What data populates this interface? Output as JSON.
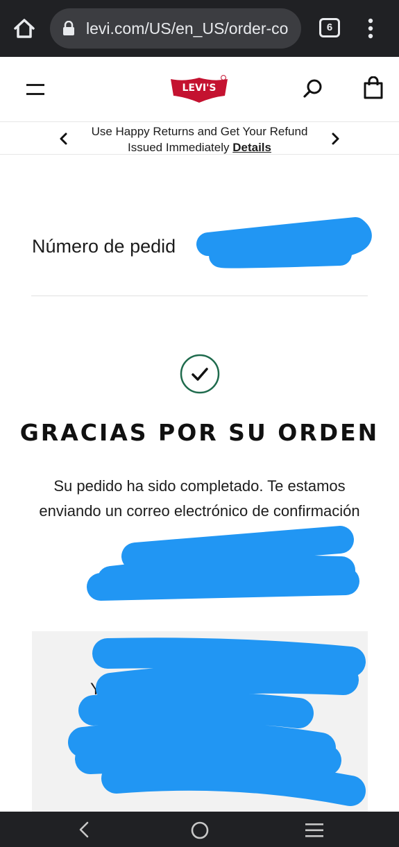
{
  "browser": {
    "url": "levi.com/US/en_US/order-co",
    "tab_count": "6"
  },
  "header": {
    "logo_text": "LEVI'S"
  },
  "promo": {
    "text_line1": "Use Happy Returns and Get Your Refund",
    "text_line2": "Issued Immediately",
    "link_label": "Details"
  },
  "order": {
    "number_label": "Número de pedid"
  },
  "confirmation": {
    "title": "GRACIAS POR SU ORDEN",
    "message": "Su pedido ha sido completado. Te estamos enviando un correo electrónico de confirmación",
    "shipping_text": "Your ship                                   n"
  },
  "colors": {
    "chrome": "#202124",
    "redaction": "#2196f3",
    "check_ring": "#1f6b4d",
    "logo_red": "#c41230"
  }
}
